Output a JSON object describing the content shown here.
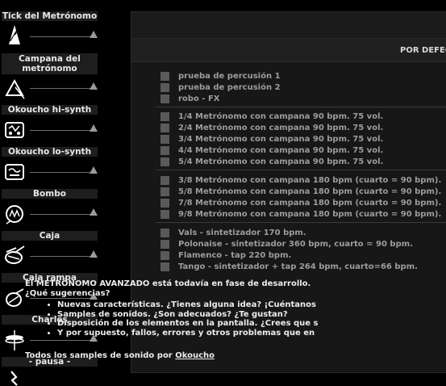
{
  "sidebar": {
    "items": [
      {
        "label": "Tick del Metrónomo",
        "icon": "metronome-icon"
      },
      {
        "label": "Campana del metrónomo",
        "icon": "triangle-bell-icon"
      },
      {
        "label": "Okoucho hi-synth",
        "icon": "synth-hi-icon"
      },
      {
        "label": "Okoucho lo-synth",
        "icon": "synth-lo-icon"
      },
      {
        "label": "Bombo",
        "icon": "bass-drum-icon"
      },
      {
        "label": "Caja",
        "icon": "snare-drum-icon"
      },
      {
        "label": "Caja rampa",
        "icon": "snare-rampa-icon"
      },
      {
        "label": "Charles",
        "icon": "hihat-icon"
      },
      {
        "label": "- pausa -",
        "icon": "rest-icon"
      }
    ]
  },
  "panel": {
    "header": "POR DEFECTO",
    "groups": [
      [
        "prueba de percusión 1",
        "prueba de percusión 2",
        "robo - FX"
      ],
      [
        "1/4 Metrónomo con campana 90 bpm. 75 vol.",
        "2/4 Metrónomo con campana 90 bpm. 75 vol.",
        "3/4 Metrónomo con campana 90 bpm. 75 vol.",
        "4/4 Metrónomo con campana 90 bpm. 75 vol.",
        "5/4 Metrónomo con campana 90 bpm. 75 vol."
      ],
      [
        "3/8 Metrónomo con campana 180 bpm (cuarto = 90 bpm).",
        "5/8 Metrónomo con campana 180 bpm (cuarto = 90 bpm).",
        "7/8 Metrónomo con campana 180 bpm (cuarto = 90 bpm).",
        "9/8 Metrónomo con campana 180 bpm (cuarto = 90 bpm)."
      ],
      [
        "Vals - sintetizador 170 bpm.",
        "Polonaise - sintetizador 360 bpm, cuarto = 90 bpm.",
        "Flamenco - tap 220 bpm.",
        "Tango - sintetizador + tap 264 bpm, cuarto=66 bpm."
      ]
    ],
    "description": {
      "line1": "El METRÓNOMO AVANZADO está todavía en fase de desarrollo. ",
      "line2": "¿Qué sugerencias?",
      "bullets": [
        "Nuevas características. ¿Tienes alguna idea? ¡Cuéntanos",
        "Samples de sonidos. ¿Son adecuados? ¿Te gustan?",
        "Disposición de los elementos en la pantalla. ¿Crees que s",
        "Y por supuesto, fallos, errores y otros problemas que en"
      ]
    },
    "credits": {
      "text": "Todos los samples de sonido por ",
      "link": "Okoucho"
    }
  }
}
